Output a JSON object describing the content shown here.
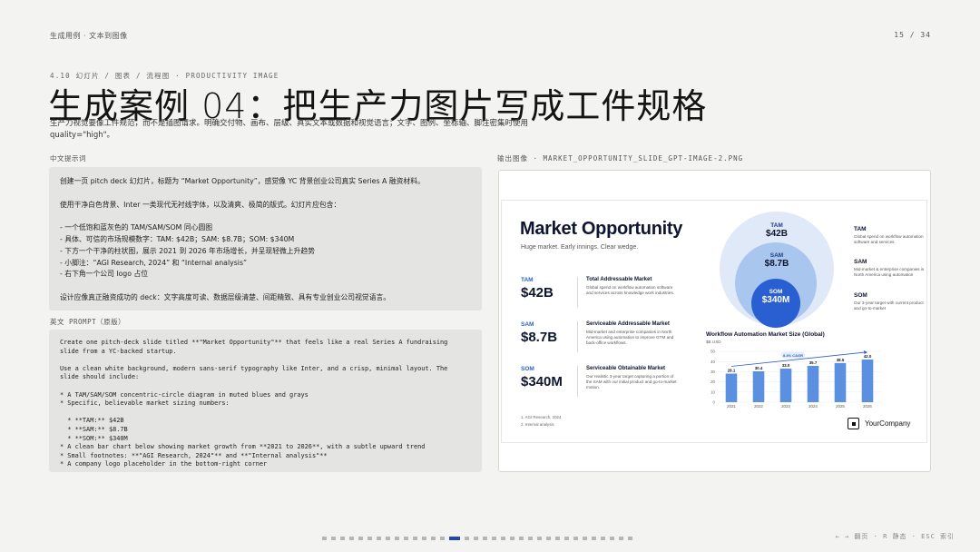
{
  "header": {
    "breadcrumb": "生成用例 · 文本到图像",
    "page": "15 / 34"
  },
  "section_tag": "4.10 幻灯片 / 图表 / 流程图 · PRODUCTIVITY IMAGE",
  "title": "生成案例 04：把生产力图片写成工件规格",
  "subtitle": "生产力视觉要像工件规范，而不是插图请求。明确交付物、画布、层级、真实文本或数据和视觉语言；文字、图例、坐标轴、脚注密集时使用 quality=\"high\"。",
  "prompt_cn": {
    "label": "中文提示词",
    "lines": [
      "创建一页 pitch deck 幻灯片，标题为 “Market Opportunity”，感觉像 YC 背景创业公司真实 Series A 融资材料。",
      "",
      "使用干净白色背景、Inter 一类现代无衬线字体，以及清爽、极简的版式。幻灯片应包含：",
      "",
      "- 一个低饱和蓝灰色的 TAM/SAM/SOM 同心圆图",
      "- 具体、可信的市场规模数字：TAM: $42B；SAM: $8.7B；SOM: $340M",
      "- 下方一个干净的柱状图，展示 2021 到 2026 年市场增长，并呈现轻微上升趋势",
      "- 小脚注：“AGI Research, 2024” 和 “Internal analysis”",
      "- 右下角一个公司 logo 占位",
      "",
      "设计应像真正融资成功的 deck：文字高度可读、数据层级清楚、间距精致、具有专业创业公司视觉语言。"
    ]
  },
  "prompt_en": {
    "label": "英文 PROMPT（原版）",
    "text": "Create one pitch-deck slide titled **\"Market Opportunity\"** that feels like a real Series A fundraising\nslide from a YC-backed startup.\n\nUse a clean white background, modern sans-serif typography like Inter, and a crisp, minimal layout. The\nslide should include:\n\n* A TAM/SAM/SOM concentric-circle diagram in muted blues and grays\n* Specific, believable market sizing numbers:\n\n  * **TAM:** $42B\n  * **SAM:** $8.7B\n  * **SOM:** $340M\n* A clean bar chart below showing market growth from **2021 to 2026**, with a subtle upward trend\n* Small footnotes: **\"AGI Research, 2024\"** and **\"Internal analysis\"**\n* A company logo placeholder in the bottom-right corner"
  },
  "output": {
    "label": "输出图像 · MARKET_OPPORTUNITY_SLIDE_GPT-IMAGE-2.PNG",
    "slide": {
      "title": "Market Opportunity",
      "subtitle": "Huge market. Early innings. Clear wedge.",
      "metrics": [
        {
          "label": "TAM",
          "value": "$42B",
          "heading": "Total Addressable Market",
          "desc": "Global spend on workflow automation software and services across knowledge work industries."
        },
        {
          "label": "SAM",
          "value": "$8.7B",
          "heading": "Serviceable Addressable Market",
          "desc": "Mid-market and enterprise companies in North America using automation to improve GTM and back-office workflows."
        },
        {
          "label": "SOM",
          "value": "$340M",
          "heading": "Serviceable Obtainable Market",
          "desc": "Our realistic 3-year target capturing a portion of the SAM with our initial product and go-to-market motion."
        }
      ],
      "footnotes": [
        "1. AGI Research, 2024",
        "2. Internal analysis"
      ],
      "circles": [
        {
          "label": "TAM",
          "value": "$42B"
        },
        {
          "label": "SAM",
          "value": "$8.7B"
        },
        {
          "label": "SOM",
          "value": "$340M"
        }
      ],
      "legend": [
        {
          "title": "TAM",
          "desc": "Global spend on workflow automation software and services"
        },
        {
          "title": "SAM",
          "desc": "Mid-market & enterprise companies in North America using automation"
        },
        {
          "title": "SOM",
          "desc": "Our 3-year target with current product and go-to-market"
        }
      ],
      "logo_text": "YourCompany"
    }
  },
  "chart_data": {
    "type": "bar",
    "title": "Workflow Automation Market Size (Global)",
    "unit": "$B USD",
    "categories": [
      "2021",
      "2022",
      "2023",
      "2024",
      "2025",
      "2026"
    ],
    "values": [
      28.1,
      30.4,
      33.0,
      35.7,
      38.5,
      42.0
    ],
    "value_labels": [
      "28.1",
      "30.4",
      "33.0",
      "35.7",
      "38.5",
      "42.0"
    ],
    "annotation": "8.4% CAGR",
    "ylim": [
      0,
      50
    ],
    "yticks": [
      0,
      10,
      20,
      30,
      40,
      50
    ],
    "bar_color": "#5b8fe0"
  },
  "nav": {
    "total": 34,
    "current": 15,
    "hint": "← → 翻页 · R 静态 · ESC 索引"
  },
  "colors": {
    "accent": "#2444b8",
    "slide_blue": "#2a5fd1"
  }
}
